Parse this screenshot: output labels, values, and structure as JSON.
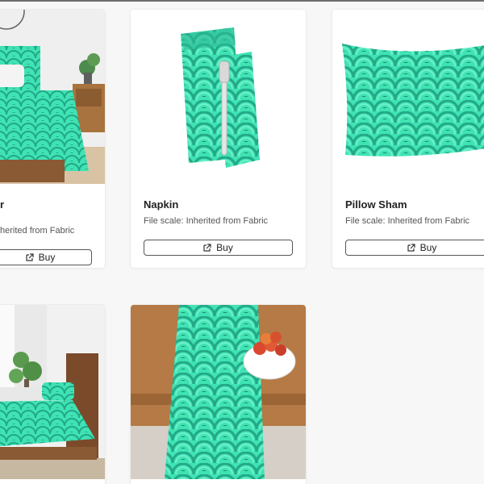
{
  "products": [
    {
      "title": "r",
      "meta_label": "herited from Fabric",
      "buy_label": "Buy",
      "image": "duvet-cover-bedroom-photo"
    },
    {
      "title": "Napkin",
      "meta_label": "File scale: Inherited from Fabric",
      "buy_label": "Buy",
      "image": "napkin-with-fork-photo"
    },
    {
      "title": "Pillow Sham",
      "meta_label": "File scale: Inherited from Fabric",
      "buy_label": "Buy",
      "image": "pillow-sham-photo"
    },
    {
      "image": "sheet-set-bedroom-photo"
    },
    {
      "image": "table-runner-photo"
    }
  ],
  "colors": {
    "fabric_teal": "#3de0b0",
    "fabric_dark": "#1f8f73",
    "wood": "#b07a45",
    "card_border": "#e6e6e6"
  },
  "icons": {
    "buy": "external-link-icon"
  }
}
